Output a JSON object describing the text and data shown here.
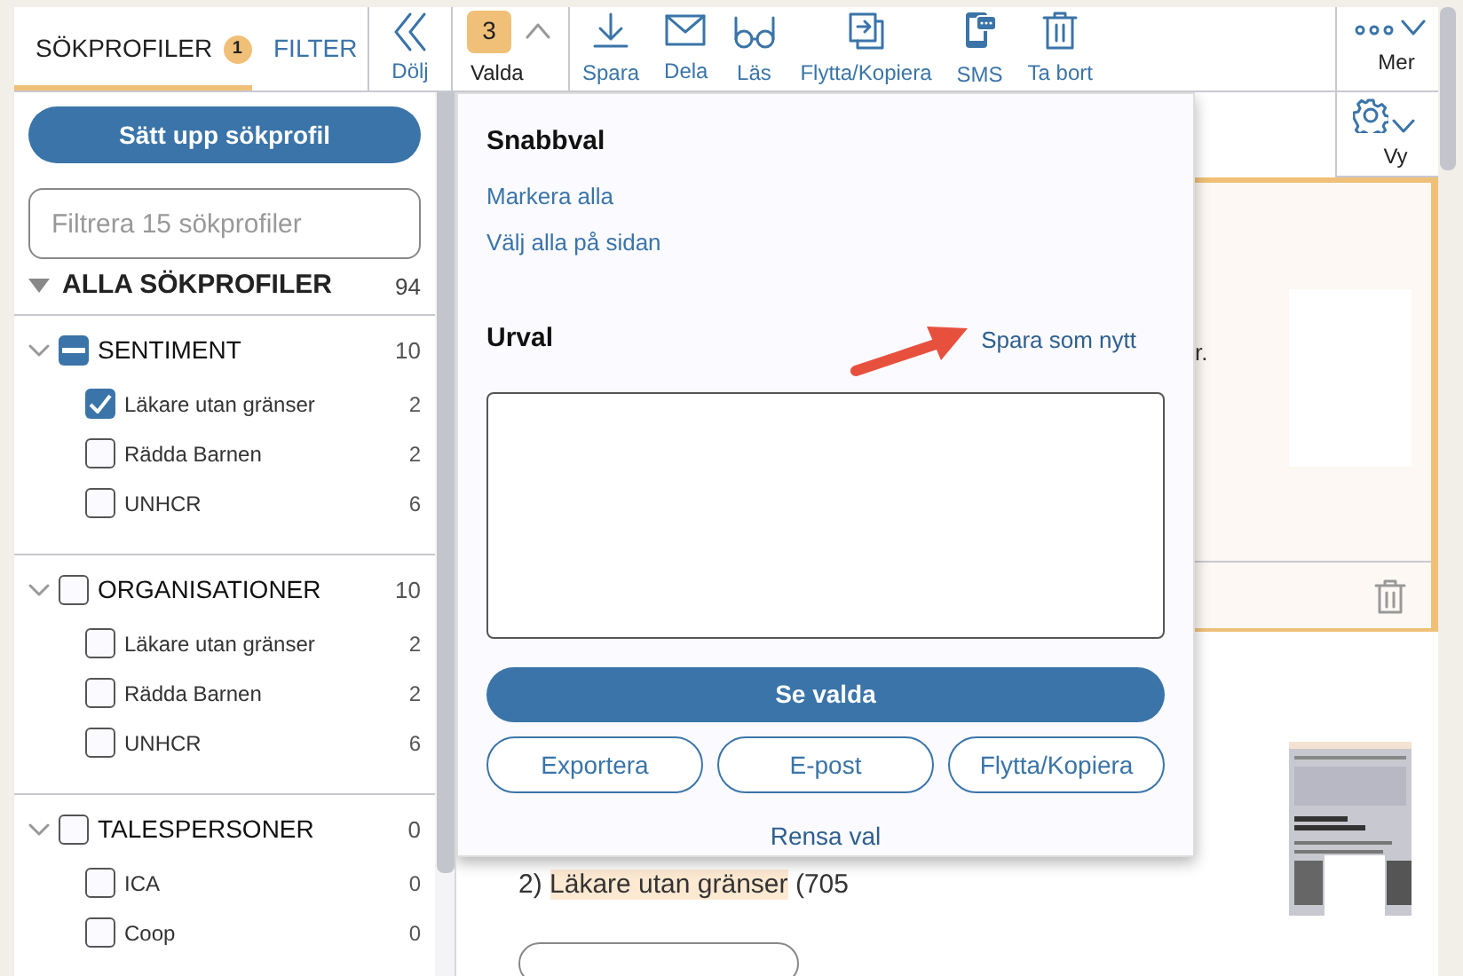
{
  "tabs": [
    {
      "label": "SÖKPROFILER",
      "badge": "1",
      "selected": true
    },
    {
      "label": "FILTER",
      "selected": false
    }
  ],
  "toolbar": [
    {
      "kind": "collapse",
      "label": "Dölj"
    },
    {
      "kind": "count",
      "count": "3",
      "label": "Valda",
      "expanded": true
    },
    {
      "kind": "action",
      "label": "Spara"
    },
    {
      "kind": "action",
      "label": "Dela"
    },
    {
      "kind": "action",
      "label": "Läs"
    },
    {
      "kind": "action",
      "label": "Flytta/Kopiera"
    },
    {
      "kind": "action",
      "label": "SMS"
    },
    {
      "kind": "action",
      "label": "Ta bort"
    }
  ],
  "more": {
    "label": "Mer"
  },
  "view": {
    "label": "Vy"
  },
  "sidebar": {
    "button": "Sätt upp sökprofil",
    "filter": {
      "placeholder": "Filtrera 15 sökprofiler"
    },
    "all": {
      "label": "ALLA SÖKPROFILER",
      "count": "94",
      "expanded": true
    },
    "groups": [
      {
        "label": "SENTIMENT",
        "count": "10",
        "expanded": true,
        "indeterminate": true,
        "children": [
          {
            "label": "Läkare utan gränser",
            "count": "2",
            "checked": true
          },
          {
            "label": "Rädda Barnen",
            "count": "2",
            "checked": false
          },
          {
            "label": "UNHCR",
            "count": "6",
            "checked": false
          }
        ]
      },
      {
        "label": "ORGANISATIONER",
        "count": "10",
        "expanded": true,
        "indeterminate": false,
        "children": [
          {
            "label": "Läkare utan gränser",
            "count": "2",
            "checked": false
          },
          {
            "label": "Rädda Barnen",
            "count": "2",
            "checked": false
          },
          {
            "label": "UNHCR",
            "count": "6",
            "checked": false
          }
        ]
      },
      {
        "label": "TALESPERSONER",
        "count": "0",
        "expanded": true,
        "indeterminate": false,
        "children": [
          {
            "label": "ICA",
            "count": "0",
            "checked": false
          },
          {
            "label": "Coop",
            "count": "0",
            "checked": false
          }
        ]
      }
    ]
  },
  "popup": {
    "quick_title": "Snabbval",
    "quick_links": [
      "Markera alla",
      "Välj alla på sidan"
    ],
    "selection_title": "Urval",
    "save_link": "Spara som nytt",
    "primary": "Se valda",
    "buttons": [
      "Exportera",
      "E-post",
      "Flytta/Kopiera"
    ],
    "clear": "Rensa val"
  },
  "background": {
    "fragment": "r.",
    "list_number": "2)",
    "highlight": "Läkare utan gränser",
    "suffix": "(705"
  }
}
